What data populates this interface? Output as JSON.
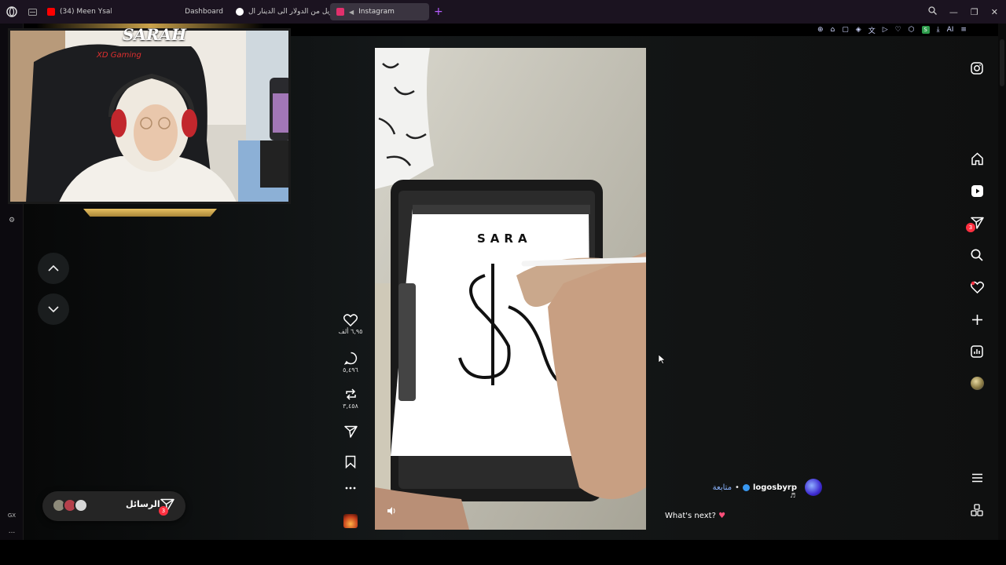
{
  "browser": {
    "tabs": [
      {
        "title": "(34) Meen Ysal",
        "favicon_color": "#ff0000"
      },
      {
        "title": "Dashboard",
        "favicon_color": "#7a5cff"
      },
      {
        "title": "تحويل من الدولار الى الدينار ال",
        "favicon_color": "#ffffff"
      },
      {
        "title": "Instagram",
        "favicon_color": "#e1306c",
        "active": true
      }
    ],
    "new_tab": "+",
    "toolbar_ai_label": "AI",
    "extension_badge": "S"
  },
  "webcam": {
    "brand": "SARAH"
  },
  "reel": {
    "drawing_text": "SARA",
    "actions": {
      "likes": "٦,٩٥ ألف",
      "comments": "٥,٤٩٦",
      "reposts": "٣,٤٥٨"
    },
    "author": "logosbyrp",
    "follow": "متابعة",
    "separator": "•",
    "caption": "What's next?",
    "caption_emoji": "♥"
  },
  "messages": {
    "label": "الرسائل",
    "badge": "3"
  },
  "ig_nav": {
    "direct_badge": "3"
  },
  "sidebar_bottom": {
    "gx": "GX",
    "more": "..."
  },
  "icons": {
    "home": "home-icon",
    "reels": "reels-icon",
    "direct": "paper-plane-icon",
    "search": "search-icon",
    "notifications": "heart-icon",
    "create": "plus-icon",
    "insights": "chart-icon",
    "profile": "profile-avatar-icon",
    "more": "hamburger-icon",
    "apps": "apps-icon"
  }
}
